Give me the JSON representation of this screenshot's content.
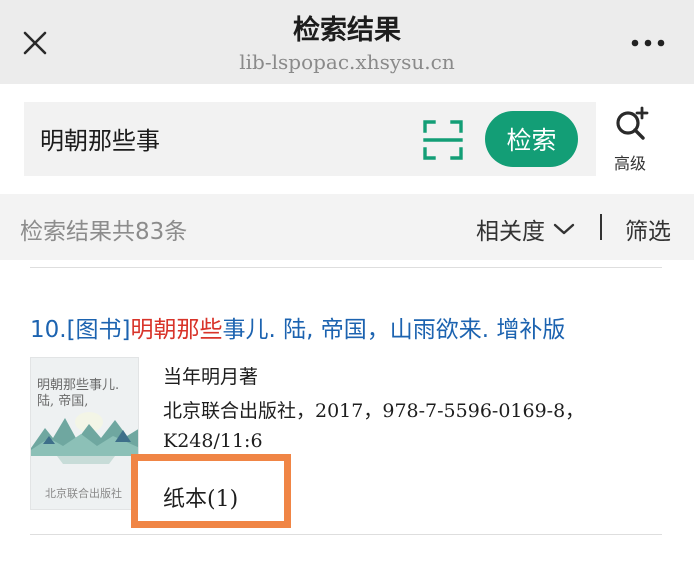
{
  "header": {
    "title": "检索结果",
    "domain": "lib-lspopac.xhsysu.cn"
  },
  "search": {
    "query": "明朝那些事",
    "button_label": "检索",
    "advanced_label": "高级"
  },
  "results_bar": {
    "summary": "检索结果共83条",
    "sort_label": "相关度",
    "filter_label": "筛选"
  },
  "results": [
    {
      "index_prefix": "10.[图书]",
      "title_highlight": "明朝那些",
      "title_rest": "事儿. 陆, 帝国，山雨欲来. 增补版",
      "cover_title": "明朝那些事儿. 陆, 帝国,",
      "cover_publisher": "北京联合出版社",
      "author": "当年明月著",
      "publication": "北京联合出版社，2017，978-7-5596-0169-8，",
      "call_number": "K248/11:6",
      "holding": "纸本(1)"
    }
  ],
  "colors": {
    "accent_green": "#139e76",
    "link_blue": "#1c63b0",
    "highlight_red": "#d8342a",
    "holding_outline": "#f08545"
  },
  "icons": {
    "close": "close-icon",
    "more": "more-dots-icon",
    "scan": "scan-icon",
    "advanced_search": "advanced-search-icon",
    "sort_chevron": "chevron-down-icon"
  }
}
